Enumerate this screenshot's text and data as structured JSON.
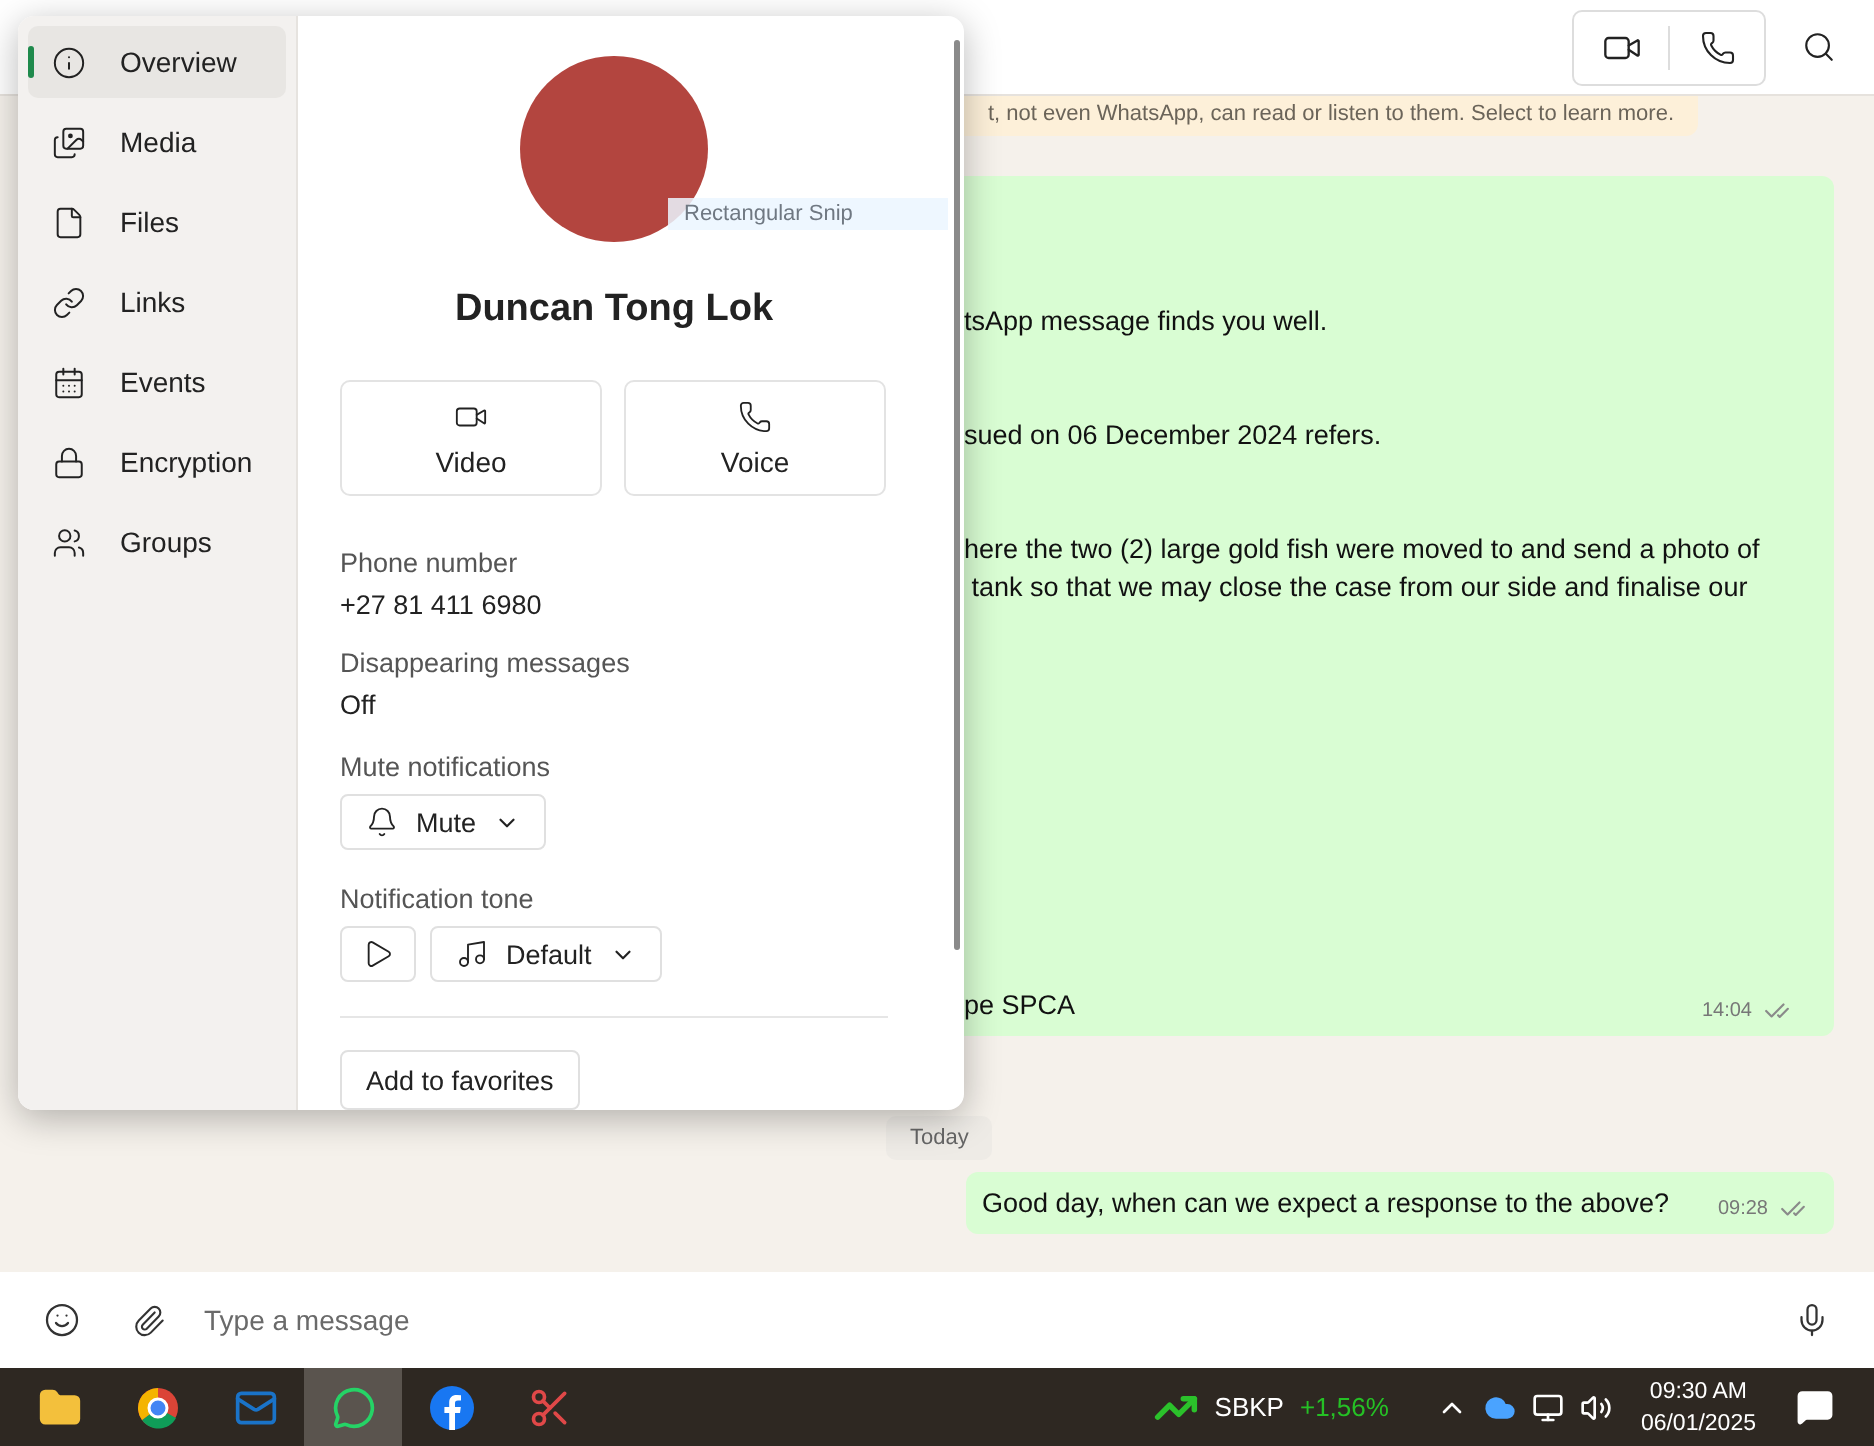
{
  "encryption_notice": "t, not even WhatsApp, can read or listen to them. Select to learn more.",
  "messages": [
    {
      "paragraphs": [
        [
          "tsApp message finds you well."
        ],
        [
          "sued on 06 December 2024 refers."
        ],
        [
          "here the two (2) large gold fish were moved to and send a photo of",
          " tank so that we may close the case from our side and finalise our"
        ],
        [
          "pe SPCA"
        ]
      ],
      "time": "14:04",
      "kind": "long"
    },
    {
      "paragraphs": [
        [
          "Good day, when can we expect a response to the above?"
        ]
      ],
      "time": "09:28",
      "kind": "short"
    }
  ],
  "date_chip": "Today",
  "composer": {
    "placeholder": "Type a message"
  },
  "panel": {
    "nav": [
      {
        "label": "Overview",
        "selected": true
      },
      {
        "label": "Media",
        "selected": false
      },
      {
        "label": "Files",
        "selected": false
      },
      {
        "label": "Links",
        "selected": false
      },
      {
        "label": "Events",
        "selected": false
      },
      {
        "label": "Encryption",
        "selected": false
      },
      {
        "label": "Groups",
        "selected": false
      }
    ],
    "snip_tooltip": "Rectangular Snip",
    "name": "Duncan Tong Lok",
    "call_buttons": [
      {
        "label": "Video",
        "kind": "video"
      },
      {
        "label": "Voice",
        "kind": "voice"
      }
    ],
    "fields": [
      {
        "label": "Phone number",
        "value": "+27 81 411 6980"
      },
      {
        "label": "Disappearing messages",
        "value": "Off"
      }
    ],
    "mute": {
      "label": "Mute notifications",
      "value": "Mute"
    },
    "tone": {
      "label": "Notification tone",
      "value": "Default"
    },
    "favorites": "Add to favorites"
  },
  "taskbar": {
    "apps": [
      {
        "active": false
      },
      {
        "active": false
      },
      {
        "active": false
      },
      {
        "active": true
      },
      {
        "active": false
      },
      {
        "active": false
      }
    ],
    "ticker": {
      "symbol": "SBKP",
      "change": "+1,56%"
    },
    "time": "09:30 AM",
    "date": "06/01/2025"
  }
}
